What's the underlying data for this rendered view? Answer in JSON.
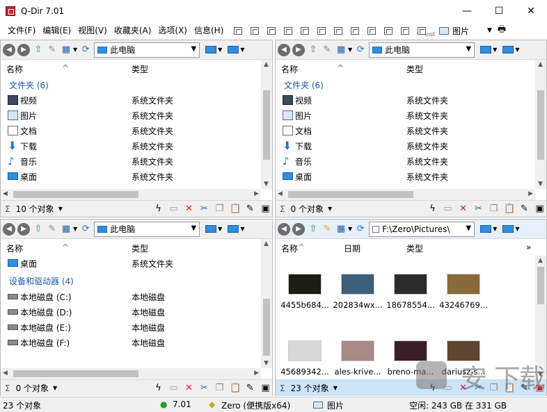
{
  "window": {
    "title": "Q-Dir 7.01",
    "minimize": "—",
    "maximize": "☐",
    "close": "✕"
  },
  "menu": {
    "items": [
      "文件(F)",
      "编辑(E)",
      "视图(V)",
      "收藏夹(A)",
      "选项(X)",
      "信息(H)"
    ],
    "tools_label": "图片",
    "inst": "inst"
  },
  "panes": [
    {
      "address": "此电脑",
      "columns": [
        "名称",
        "类型"
      ],
      "group": "文件夹 (6)",
      "rows": [
        {
          "name": "视频",
          "type": "系统文件夹",
          "icon": "video-icon"
        },
        {
          "name": "图片",
          "type": "系统文件夹",
          "icon": "pictures-icon"
        },
        {
          "name": "文档",
          "type": "系统文件夹",
          "icon": "documents-icon"
        },
        {
          "name": "下载",
          "type": "系统文件夹",
          "icon": "download-icon"
        },
        {
          "name": "音乐",
          "type": "系统文件夹",
          "icon": "music-icon"
        },
        {
          "name": "桌面",
          "type": "系统文件夹",
          "icon": "desktop-icon"
        }
      ],
      "status_count": "10 个对象"
    },
    {
      "address": "此电脑",
      "columns": [
        "名称",
        "类型"
      ],
      "group": "文件夹 (6)",
      "rows": [
        {
          "name": "视频",
          "type": "系统文件夹",
          "icon": "video-icon"
        },
        {
          "name": "图片",
          "type": "系统文件夹",
          "icon": "pictures-icon"
        },
        {
          "name": "文档",
          "type": "系统文件夹",
          "icon": "documents-icon"
        },
        {
          "name": "下载",
          "type": "系统文件夹",
          "icon": "download-icon"
        },
        {
          "name": "音乐",
          "type": "系统文件夹",
          "icon": "music-icon"
        },
        {
          "name": "桌面",
          "type": "系统文件夹",
          "icon": "desktop-icon"
        }
      ],
      "status_count": "0 个对象"
    },
    {
      "address": "此电脑",
      "columns": [
        "名称",
        "类型"
      ],
      "top_row": {
        "name": "桌面",
        "type": "系统文件夹"
      },
      "group": "设备和驱动器 (4)",
      "rows": [
        {
          "name": "本地磁盘 (C:)",
          "type": "本地磁盘",
          "icon": "drive-icon"
        },
        {
          "name": "本地磁盘 (D:)",
          "type": "本地磁盘",
          "icon": "drive-icon"
        },
        {
          "name": "本地磁盘 (E:)",
          "type": "本地磁盘",
          "icon": "drive-icon"
        },
        {
          "name": "本地磁盘 (F:)",
          "type": "本地磁盘",
          "icon": "drive-icon"
        }
      ],
      "status_count": "0 个对象"
    },
    {
      "address": "F:\\Zero\\Pictures\\",
      "columns": [
        "名称",
        "日期",
        "类型"
      ],
      "more": "»",
      "thumbnails": [
        {
          "label": "4455b684...",
          "color": "#1a1f14"
        },
        {
          "label": "202834wx...",
          "color": "#3d5f7a"
        },
        {
          "label": "18678554...",
          "color": "#2c2c2c"
        },
        {
          "label": "43246769...",
          "color": "#8a6a3a"
        },
        {
          "label": "45689342...",
          "color": "#d8d8d8"
        },
        {
          "label": "ales-krive...",
          "color": "#a88a86"
        },
        {
          "label": "breno-ma...",
          "color": "#3b1e2a"
        },
        {
          "label": "dariusz-s...",
          "color": "#5e4530"
        }
      ],
      "status_count": "23 个对象"
    }
  ],
  "bottom": {
    "count": "23 个对象",
    "version": "7.01",
    "user": "Zero (便携版x64)",
    "folder": "图片",
    "space": "空闲: 243 GB 在 331 GB"
  }
}
